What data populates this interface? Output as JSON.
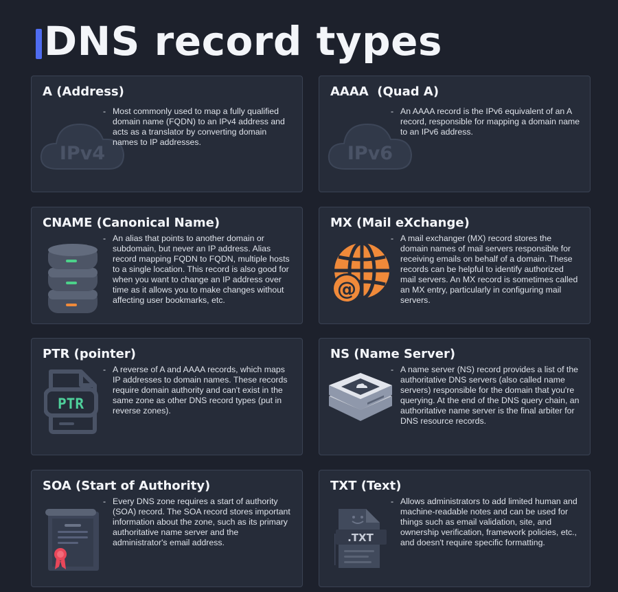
{
  "page": {
    "title": "DNS record types"
  },
  "cards": [
    {
      "title": "A (Address)",
      "icon": "cloud-ipv4-icon",
      "icon_text": "IPv4",
      "description": "Most commonly used to map a fully qualified domain name (FQDN) to an IPv4 address and acts as a translator by converting domain names to IP addresses."
    },
    {
      "title": "AAAA  (Quad A)",
      "icon": "cloud-ipv6-icon",
      "icon_text": "IPv6",
      "description": "An AAAA record is the IPv6 equivalent of an A record, responsible for mapping a domain name to an IPv6 address."
    },
    {
      "title": "CNAME (Canonical Name)",
      "icon": "server-stack-icon",
      "description": "An alias that points to another domain or subdomain, but never an IP address. Alias record mapping FQDN to FQDN, multiple hosts to a single location. This record is also good for when you want to change an IP address over time as it allows you to make changes without affecting user bookmarks, etc."
    },
    {
      "title": "MX (Mail eXchange)",
      "icon": "globe-mail-icon",
      "icon_text": "@",
      "description": "A mail exchanger (MX) record stores the domain names of mail servers responsible for receiving emails on behalf of a domain. These records can be helpful to identify authorized mail servers. An MX record is sometimes called an MX entry, particularly in configuring mail servers."
    },
    {
      "title": "PTR (pointer)",
      "icon": "ptr-file-icon",
      "icon_text": "PTR",
      "description": "A reverse of A and AAAA records, which maps IP addresses to domain names. These records require domain authority and can't exist in the same zone as other DNS record types (put in reverse zones)."
    },
    {
      "title": "NS (Name Server)",
      "icon": "name-server-icon",
      "description": "A name server (NS) record provides a list of the authoritative DNS servers (also called name servers) responsible for the domain that you're querying. At the end of the DNS query chain, an authoritative name server is the final arbiter for DNS resource records."
    },
    {
      "title": "SOA (Start of Authority)",
      "icon": "certificate-icon",
      "description": "Every DNS zone requires a start of authority (SOA) record. The SOA record stores important information about the zone, such as its primary authoritative name server and the administrator's email address."
    },
    {
      "title": "TXT (Text)",
      "icon": "txt-file-icon",
      "icon_text": ".TXT",
      "description": "Allows administrators to add limited human and machine-readable notes and can be used for things such as email validation, site, and ownership verification, framework policies, etc., and doesn't require specific formatting."
    }
  ]
}
